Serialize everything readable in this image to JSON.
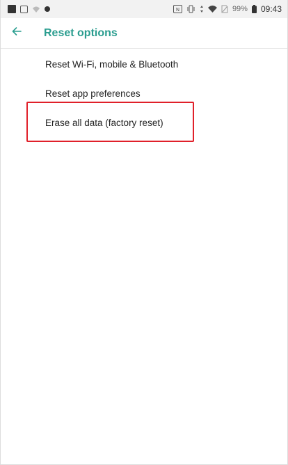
{
  "status_bar": {
    "left_icons": [
      "notification-square-icon",
      "image-icon",
      "wifi-off-icon",
      "dot-icon"
    ],
    "right_icons": [
      "nfc-icon",
      "vibrate-icon",
      "data-arrows-icon",
      "signal-icon",
      "no-sim-icon",
      "battery-icon"
    ],
    "battery": "99%",
    "time": "09:43"
  },
  "appbar": {
    "back_icon": "arrow-back-icon",
    "title": "Reset options"
  },
  "options": [
    {
      "label": "Reset Wi-Fi, mobile & Bluetooth"
    },
    {
      "label": "Reset app preferences"
    },
    {
      "label": "Erase all data (factory reset)"
    }
  ],
  "colors": {
    "accent": "#2a9d8f",
    "highlight": "#e0202a"
  }
}
